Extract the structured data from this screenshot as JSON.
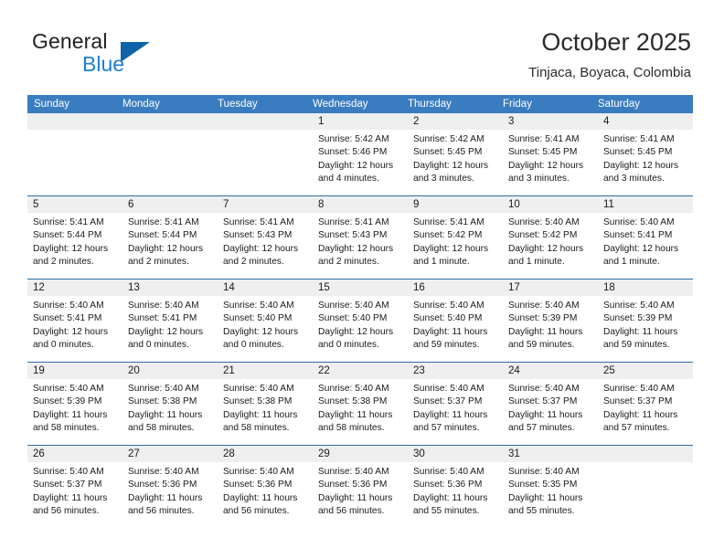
{
  "brand": {
    "name_part1": "General",
    "name_part2": "Blue",
    "logo_icon": "triangle-logo-icon",
    "accent_color": "#0d62a8",
    "blue_text_color": "#1c7fd4"
  },
  "header": {
    "title": "October 2025",
    "subtitle": "Tinjaca, Boyaca, Colombia"
  },
  "calendar": {
    "header_bg_color": "#3a7cc0",
    "row_divider_color": "#2e6da4",
    "daynum_bg_color": "#efefef",
    "weekday_headers": [
      "Sunday",
      "Monday",
      "Tuesday",
      "Wednesday",
      "Thursday",
      "Friday",
      "Saturday"
    ],
    "weeks": [
      [
        {
          "day": "",
          "sunrise": "",
          "sunset": "",
          "daylight_line1": "",
          "daylight_line2": "",
          "empty": true
        },
        {
          "day": "",
          "sunrise": "",
          "sunset": "",
          "daylight_line1": "",
          "daylight_line2": "",
          "empty": true
        },
        {
          "day": "",
          "sunrise": "",
          "sunset": "",
          "daylight_line1": "",
          "daylight_line2": "",
          "empty": true
        },
        {
          "day": "1",
          "sunrise": "Sunrise: 5:42 AM",
          "sunset": "Sunset: 5:46 PM",
          "daylight_line1": "Daylight: 12 hours",
          "daylight_line2": "and 4 minutes.",
          "empty": false
        },
        {
          "day": "2",
          "sunrise": "Sunrise: 5:42 AM",
          "sunset": "Sunset: 5:45 PM",
          "daylight_line1": "Daylight: 12 hours",
          "daylight_line2": "and 3 minutes.",
          "empty": false
        },
        {
          "day": "3",
          "sunrise": "Sunrise: 5:41 AM",
          "sunset": "Sunset: 5:45 PM",
          "daylight_line1": "Daylight: 12 hours",
          "daylight_line2": "and 3 minutes.",
          "empty": false
        },
        {
          "day": "4",
          "sunrise": "Sunrise: 5:41 AM",
          "sunset": "Sunset: 5:45 PM",
          "daylight_line1": "Daylight: 12 hours",
          "daylight_line2": "and 3 minutes.",
          "empty": false
        }
      ],
      [
        {
          "day": "5",
          "sunrise": "Sunrise: 5:41 AM",
          "sunset": "Sunset: 5:44 PM",
          "daylight_line1": "Daylight: 12 hours",
          "daylight_line2": "and 2 minutes.",
          "empty": false
        },
        {
          "day": "6",
          "sunrise": "Sunrise: 5:41 AM",
          "sunset": "Sunset: 5:44 PM",
          "daylight_line1": "Daylight: 12 hours",
          "daylight_line2": "and 2 minutes.",
          "empty": false
        },
        {
          "day": "7",
          "sunrise": "Sunrise: 5:41 AM",
          "sunset": "Sunset: 5:43 PM",
          "daylight_line1": "Daylight: 12 hours",
          "daylight_line2": "and 2 minutes.",
          "empty": false
        },
        {
          "day": "8",
          "sunrise": "Sunrise: 5:41 AM",
          "sunset": "Sunset: 5:43 PM",
          "daylight_line1": "Daylight: 12 hours",
          "daylight_line2": "and 2 minutes.",
          "empty": false
        },
        {
          "day": "9",
          "sunrise": "Sunrise: 5:41 AM",
          "sunset": "Sunset: 5:42 PM",
          "daylight_line1": "Daylight: 12 hours",
          "daylight_line2": "and 1 minute.",
          "empty": false
        },
        {
          "day": "10",
          "sunrise": "Sunrise: 5:40 AM",
          "sunset": "Sunset: 5:42 PM",
          "daylight_line1": "Daylight: 12 hours",
          "daylight_line2": "and 1 minute.",
          "empty": false
        },
        {
          "day": "11",
          "sunrise": "Sunrise: 5:40 AM",
          "sunset": "Sunset: 5:41 PM",
          "daylight_line1": "Daylight: 12 hours",
          "daylight_line2": "and 1 minute.",
          "empty": false
        }
      ],
      [
        {
          "day": "12",
          "sunrise": "Sunrise: 5:40 AM",
          "sunset": "Sunset: 5:41 PM",
          "daylight_line1": "Daylight: 12 hours",
          "daylight_line2": "and 0 minutes.",
          "empty": false
        },
        {
          "day": "13",
          "sunrise": "Sunrise: 5:40 AM",
          "sunset": "Sunset: 5:41 PM",
          "daylight_line1": "Daylight: 12 hours",
          "daylight_line2": "and 0 minutes.",
          "empty": false
        },
        {
          "day": "14",
          "sunrise": "Sunrise: 5:40 AM",
          "sunset": "Sunset: 5:40 PM",
          "daylight_line1": "Daylight: 12 hours",
          "daylight_line2": "and 0 minutes.",
          "empty": false
        },
        {
          "day": "15",
          "sunrise": "Sunrise: 5:40 AM",
          "sunset": "Sunset: 5:40 PM",
          "daylight_line1": "Daylight: 12 hours",
          "daylight_line2": "and 0 minutes.",
          "empty": false
        },
        {
          "day": "16",
          "sunrise": "Sunrise: 5:40 AM",
          "sunset": "Sunset: 5:40 PM",
          "daylight_line1": "Daylight: 11 hours",
          "daylight_line2": "and 59 minutes.",
          "empty": false
        },
        {
          "day": "17",
          "sunrise": "Sunrise: 5:40 AM",
          "sunset": "Sunset: 5:39 PM",
          "daylight_line1": "Daylight: 11 hours",
          "daylight_line2": "and 59 minutes.",
          "empty": false
        },
        {
          "day": "18",
          "sunrise": "Sunrise: 5:40 AM",
          "sunset": "Sunset: 5:39 PM",
          "daylight_line1": "Daylight: 11 hours",
          "daylight_line2": "and 59 minutes.",
          "empty": false
        }
      ],
      [
        {
          "day": "19",
          "sunrise": "Sunrise: 5:40 AM",
          "sunset": "Sunset: 5:39 PM",
          "daylight_line1": "Daylight: 11 hours",
          "daylight_line2": "and 58 minutes.",
          "empty": false
        },
        {
          "day": "20",
          "sunrise": "Sunrise: 5:40 AM",
          "sunset": "Sunset: 5:38 PM",
          "daylight_line1": "Daylight: 11 hours",
          "daylight_line2": "and 58 minutes.",
          "empty": false
        },
        {
          "day": "21",
          "sunrise": "Sunrise: 5:40 AM",
          "sunset": "Sunset: 5:38 PM",
          "daylight_line1": "Daylight: 11 hours",
          "daylight_line2": "and 58 minutes.",
          "empty": false
        },
        {
          "day": "22",
          "sunrise": "Sunrise: 5:40 AM",
          "sunset": "Sunset: 5:38 PM",
          "daylight_line1": "Daylight: 11 hours",
          "daylight_line2": "and 58 minutes.",
          "empty": false
        },
        {
          "day": "23",
          "sunrise": "Sunrise: 5:40 AM",
          "sunset": "Sunset: 5:37 PM",
          "daylight_line1": "Daylight: 11 hours",
          "daylight_line2": "and 57 minutes.",
          "empty": false
        },
        {
          "day": "24",
          "sunrise": "Sunrise: 5:40 AM",
          "sunset": "Sunset: 5:37 PM",
          "daylight_line1": "Daylight: 11 hours",
          "daylight_line2": "and 57 minutes.",
          "empty": false
        },
        {
          "day": "25",
          "sunrise": "Sunrise: 5:40 AM",
          "sunset": "Sunset: 5:37 PM",
          "daylight_line1": "Daylight: 11 hours",
          "daylight_line2": "and 57 minutes.",
          "empty": false
        }
      ],
      [
        {
          "day": "26",
          "sunrise": "Sunrise: 5:40 AM",
          "sunset": "Sunset: 5:37 PM",
          "daylight_line1": "Daylight: 11 hours",
          "daylight_line2": "and 56 minutes.",
          "empty": false
        },
        {
          "day": "27",
          "sunrise": "Sunrise: 5:40 AM",
          "sunset": "Sunset: 5:36 PM",
          "daylight_line1": "Daylight: 11 hours",
          "daylight_line2": "and 56 minutes.",
          "empty": false
        },
        {
          "day": "28",
          "sunrise": "Sunrise: 5:40 AM",
          "sunset": "Sunset: 5:36 PM",
          "daylight_line1": "Daylight: 11 hours",
          "daylight_line2": "and 56 minutes.",
          "empty": false
        },
        {
          "day": "29",
          "sunrise": "Sunrise: 5:40 AM",
          "sunset": "Sunset: 5:36 PM",
          "daylight_line1": "Daylight: 11 hours",
          "daylight_line2": "and 56 minutes.",
          "empty": false
        },
        {
          "day": "30",
          "sunrise": "Sunrise: 5:40 AM",
          "sunset": "Sunset: 5:36 PM",
          "daylight_line1": "Daylight: 11 hours",
          "daylight_line2": "and 55 minutes.",
          "empty": false
        },
        {
          "day": "31",
          "sunrise": "Sunrise: 5:40 AM",
          "sunset": "Sunset: 5:35 PM",
          "daylight_line1": "Daylight: 11 hours",
          "daylight_line2": "and 55 minutes.",
          "empty": false
        },
        {
          "day": "",
          "sunrise": "",
          "sunset": "",
          "daylight_line1": "",
          "daylight_line2": "",
          "empty": true
        }
      ]
    ]
  }
}
